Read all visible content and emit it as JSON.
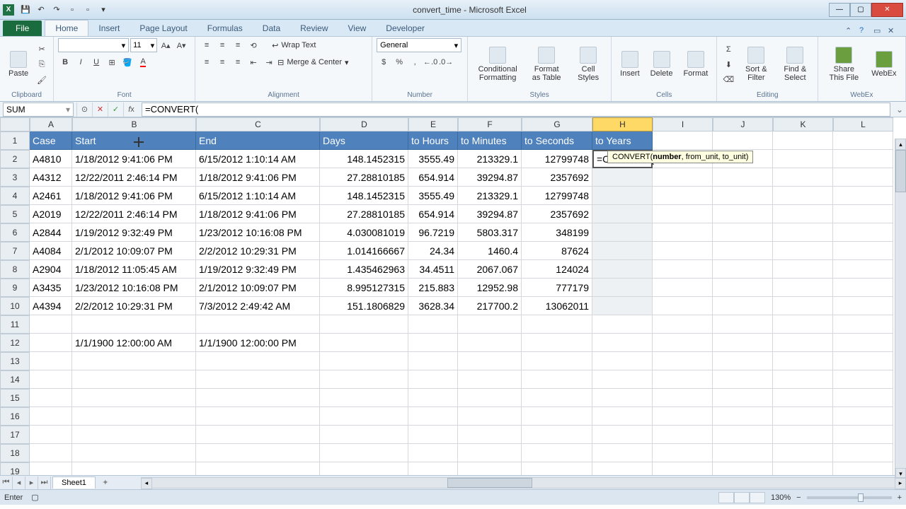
{
  "title": "convert_time - Microsoft Excel",
  "ribbon_tabs": [
    "File",
    "Home",
    "Insert",
    "Page Layout",
    "Formulas",
    "Data",
    "Review",
    "View",
    "Developer"
  ],
  "active_tab": "Home",
  "groups": {
    "clipboard": {
      "label": "Clipboard",
      "paste": "Paste"
    },
    "font": {
      "label": "Font",
      "name": "",
      "size": "11"
    },
    "alignment": {
      "label": "Alignment",
      "wrap": "Wrap Text",
      "merge": "Merge & Center"
    },
    "number": {
      "label": "Number",
      "format": "General"
    },
    "styles": {
      "label": "Styles",
      "cond": "Conditional Formatting",
      "table": "Format as Table",
      "cell": "Cell Styles"
    },
    "cells": {
      "label": "Cells",
      "insert": "Insert",
      "delete": "Delete",
      "format": "Format"
    },
    "editing": {
      "label": "Editing",
      "sort": "Sort & Filter",
      "find": "Find & Select"
    },
    "webex": {
      "label": "WebEx",
      "share": "Share This File",
      "wx": "WebEx"
    }
  },
  "name_box": "SUM",
  "formula": "=CONVERT(",
  "tooltip": {
    "fn": "CONVERT(",
    "args": "number, from_unit, to_unit)"
  },
  "columns": [
    "A",
    "B",
    "C",
    "D",
    "E",
    "F",
    "G",
    "H",
    "I",
    "J",
    "K",
    "L"
  ],
  "active_col": "H",
  "headers": [
    "Case",
    "Start",
    "End",
    "Days",
    "to Hours",
    "to Minutes",
    "to Seconds",
    "to Years"
  ],
  "rows": [
    {
      "n": 2,
      "A": "A4810",
      "B": "1/18/2012 9:41:06 PM",
      "C": "6/15/2012 1:10:14 AM",
      "D": "148.1452315",
      "E": "3555.49",
      "F": "213329.1",
      "G": "12799748",
      "H": "=CONVERT("
    },
    {
      "n": 3,
      "A": "A4312",
      "B": "12/22/2011 2:46:14 PM",
      "C": "1/18/2012 9:41:06 PM",
      "D": "27.28810185",
      "E": "654.914",
      "F": "39294.87",
      "G": "2357692",
      "H": ""
    },
    {
      "n": 4,
      "A": "A2461",
      "B": "1/18/2012 9:41:06 PM",
      "C": "6/15/2012 1:10:14 AM",
      "D": "148.1452315",
      "E": "3555.49",
      "F": "213329.1",
      "G": "12799748",
      "H": ""
    },
    {
      "n": 5,
      "A": "A2019",
      "B": "12/22/2011 2:46:14 PM",
      "C": "1/18/2012 9:41:06 PM",
      "D": "27.28810185",
      "E": "654.914",
      "F": "39294.87",
      "G": "2357692",
      "H": ""
    },
    {
      "n": 6,
      "A": "A2844",
      "B": "1/19/2012 9:32:49 PM",
      "C": "1/23/2012 10:16:08 PM",
      "D": "4.030081019",
      "E": "96.7219",
      "F": "5803.317",
      "G": "348199",
      "H": ""
    },
    {
      "n": 7,
      "A": "A4084",
      "B": "2/1/2012 10:09:07 PM",
      "C": "2/2/2012 10:29:31 PM",
      "D": "1.014166667",
      "E": "24.34",
      "F": "1460.4",
      "G": "87624",
      "H": ""
    },
    {
      "n": 8,
      "A": "A2904",
      "B": "1/18/2012 11:05:45 AM",
      "C": "1/19/2012 9:32:49 PM",
      "D": "1.435462963",
      "E": "34.4511",
      "F": "2067.067",
      "G": "124024",
      "H": ""
    },
    {
      "n": 9,
      "A": "A3435",
      "B": "1/23/2012 10:16:08 PM",
      "C": "2/1/2012 10:09:07 PM",
      "D": "8.995127315",
      "E": "215.883",
      "F": "12952.98",
      "G": "777179",
      "H": ""
    },
    {
      "n": 10,
      "A": "A4394",
      "B": "2/2/2012 10:29:31 PM",
      "C": "7/3/2012 2:49:42 AM",
      "D": "151.1806829",
      "E": "3628.34",
      "F": "217700.2",
      "G": "13062011",
      "H": ""
    }
  ],
  "extra_row": {
    "n": 12,
    "B": "1/1/1900 12:00:00 AM",
    "C": "1/1/1900 12:00:00 PM"
  },
  "empty_rows": [
    11,
    13,
    14,
    15,
    16,
    17,
    18,
    19
  ],
  "sheet": "Sheet1",
  "status": "Enter",
  "zoom": "130%"
}
